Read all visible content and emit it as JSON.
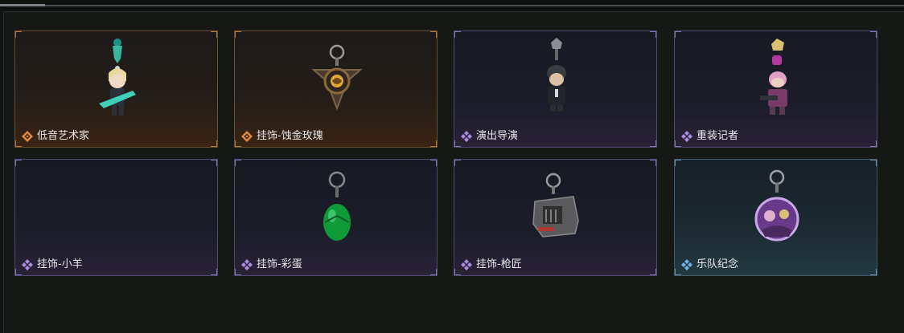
{
  "items": [
    {
      "name": "低音艺术家",
      "rarity": "gold",
      "icon": "bass-artist-charm-icon"
    },
    {
      "name": "挂饰-蚀金玫瑰",
      "rarity": "gold",
      "icon": "gilded-rose-charm-icon"
    },
    {
      "name": "演出导演",
      "rarity": "purple",
      "icon": "show-director-charm-icon"
    },
    {
      "name": "重装记者",
      "rarity": "purple",
      "icon": "heavy-reporter-charm-icon"
    },
    {
      "name": "挂饰-小羊",
      "rarity": "purple",
      "icon": "lamb-charm-icon"
    },
    {
      "name": "挂饰-彩蛋",
      "rarity": "purple",
      "icon": "easter-egg-charm-icon"
    },
    {
      "name": "挂饰-枪匠",
      "rarity": "purple",
      "icon": "gunsmith-charm-icon"
    },
    {
      "name": "乐队纪念",
      "rarity": "blue",
      "icon": "band-memorial-charm-icon"
    }
  ],
  "colors": {
    "gold": "#e0893c",
    "purple": "#a98be0",
    "blue": "#6fb3e6"
  }
}
